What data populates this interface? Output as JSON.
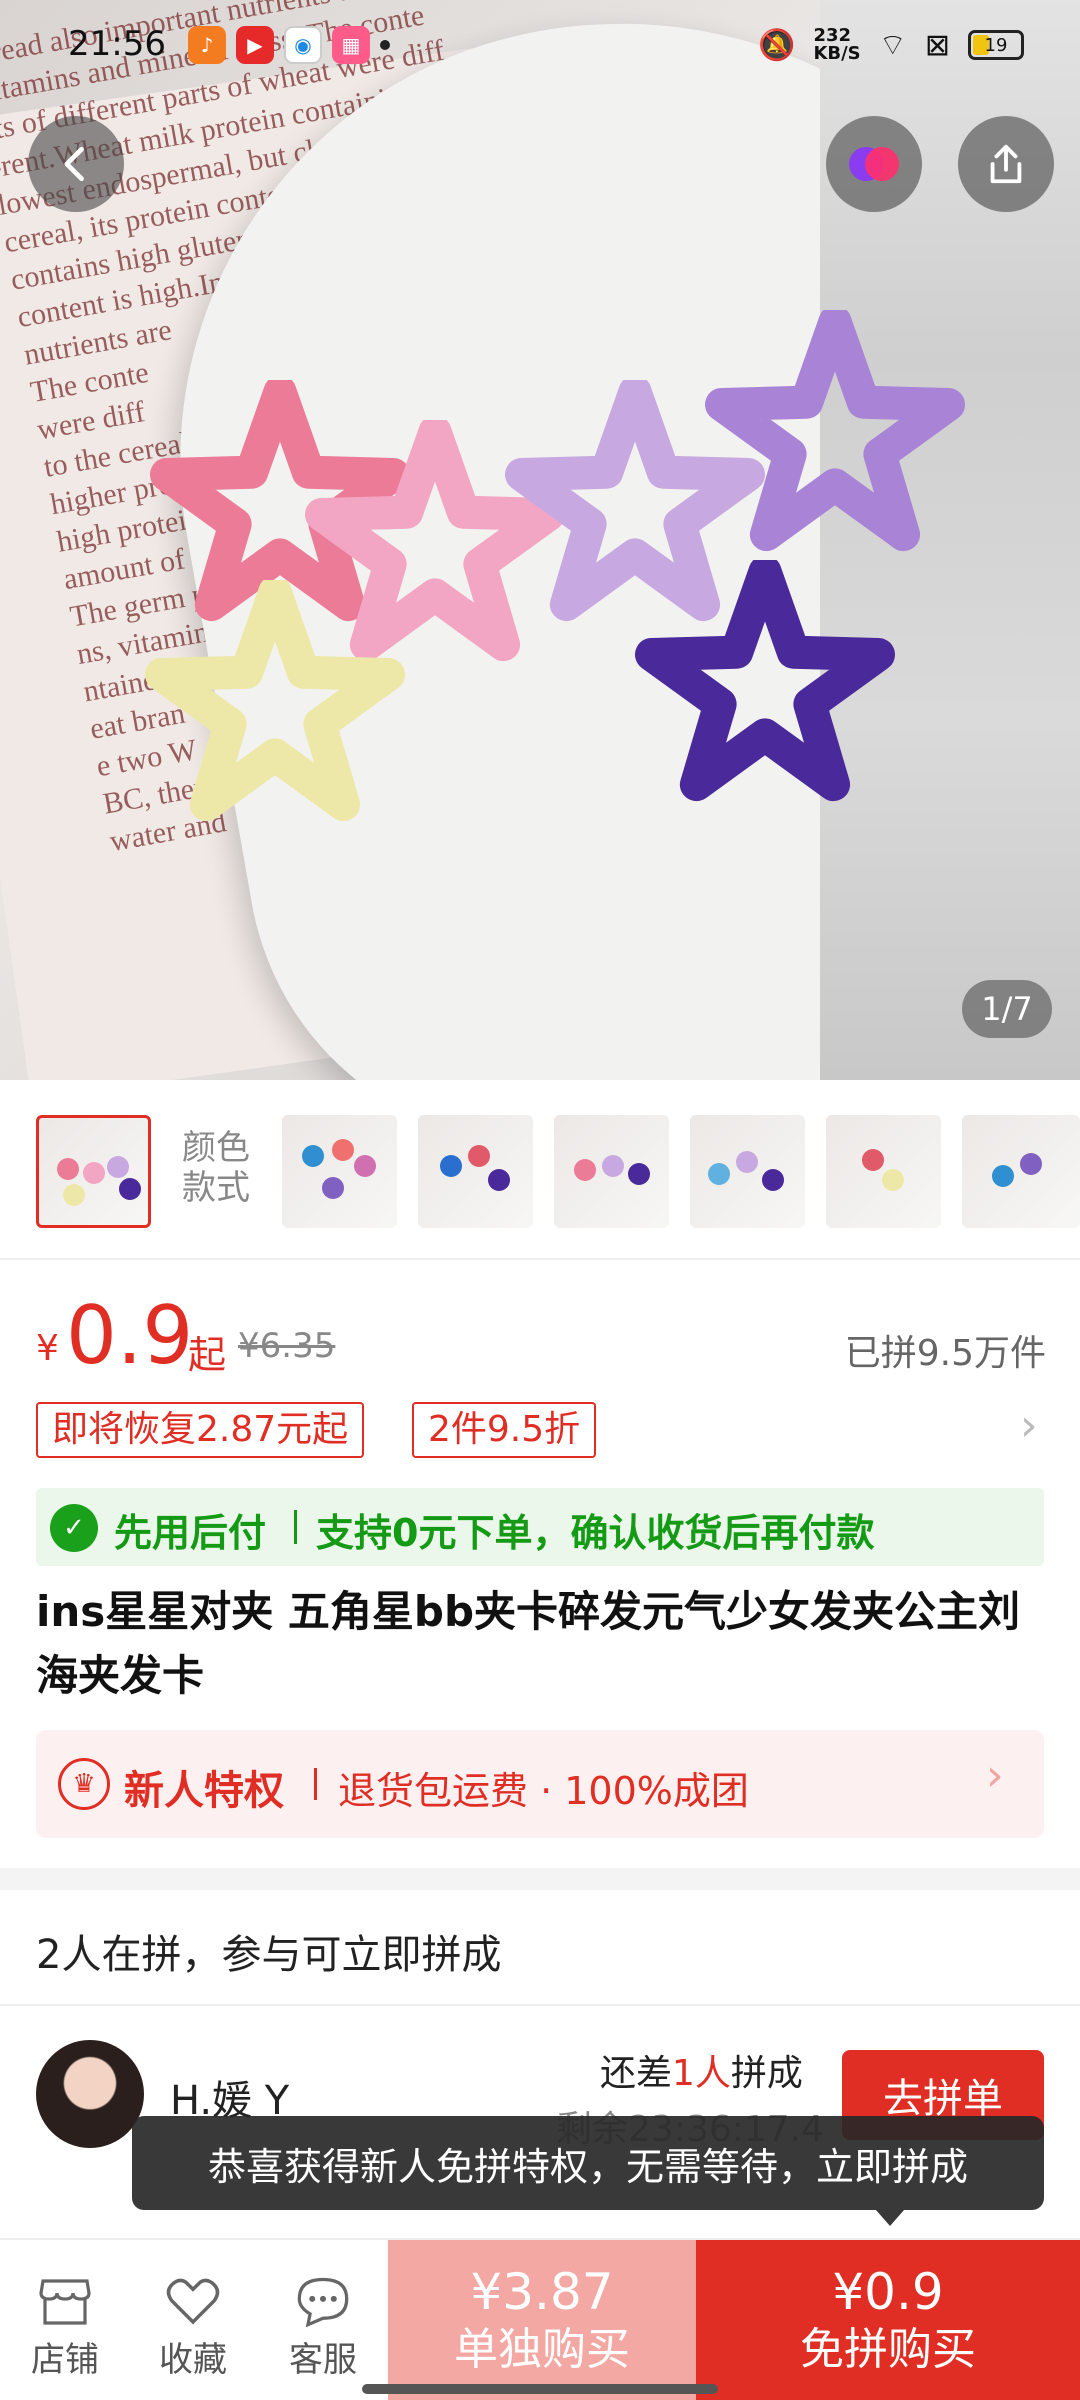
{
  "status_bar": {
    "time": "21:56",
    "net_speed": "232\nKB/S",
    "battery": "19"
  },
  "hero": {
    "page_indicator": "1/7"
  },
  "thumbnails": {
    "color_label_1": "颜色",
    "color_label_2": "款式",
    "count": 8
  },
  "price": {
    "currency": "¥",
    "value": "0.9",
    "suffix": "起",
    "original": "¥6.35",
    "sold": "已拼9.5万件"
  },
  "tags": [
    "即将恢复2.87元起",
    "2件9.5折"
  ],
  "pay_banner": {
    "title": "先用后付",
    "desc": "支持0元下单，确认收货后再付款"
  },
  "product_title": "ins星星对夹 五角星bb夹卡碎发元气少女发夹公主刘海夹发卡",
  "newbie": {
    "title": "新人特权",
    "desc": "退货包运费 · 100%成团"
  },
  "group": {
    "header": "2人在拼，参与可立即拼成",
    "rows": [
      {
        "name": "H.媛 Y",
        "need_prefix": "还差",
        "need_count": "1人",
        "need_suffix": "拼成",
        "remaining": "剩余23:36:17.4",
        "button": "去拼单"
      }
    ]
  },
  "toast": "恭喜获得新人免拼特权，无需等待，立即拼成",
  "bottom_bar": {
    "shop": "店铺",
    "favorite": "收藏",
    "service": "客服",
    "single_price": "¥3.87",
    "single_label": "单独购买",
    "group_price": "¥0.9",
    "group_label": "免拼购买"
  },
  "colors": {
    "accent": "#e02e24",
    "green": "#149a14"
  }
}
